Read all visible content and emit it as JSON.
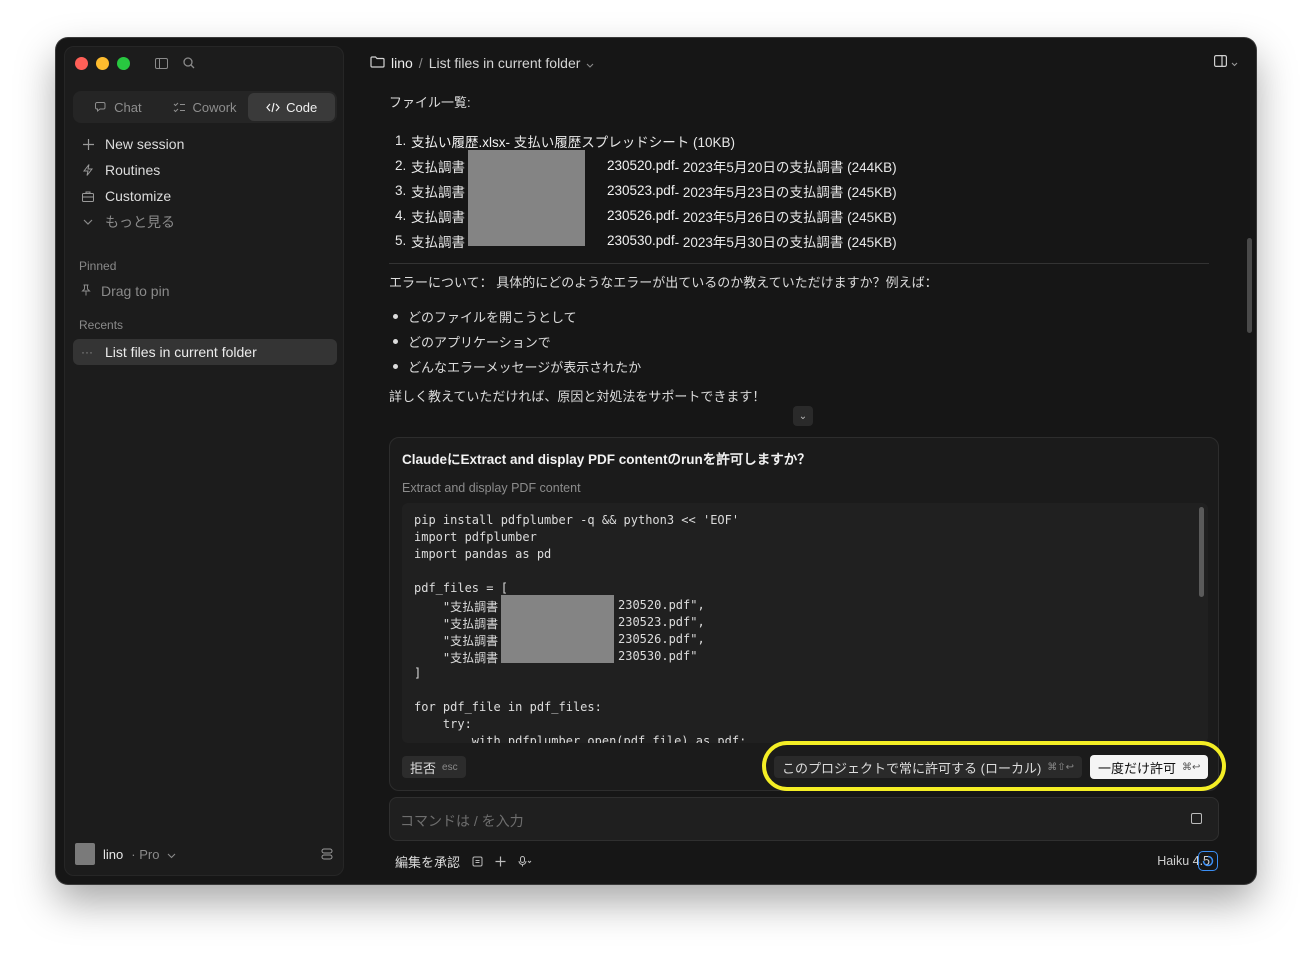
{
  "sidebar": {
    "modes": [
      {
        "label": "Chat",
        "icon": "chat-icon"
      },
      {
        "label": "Cowork",
        "icon": "cowork-icon"
      },
      {
        "label": "Code",
        "icon": "code-icon",
        "active": true
      }
    ],
    "nav": [
      {
        "label": "New session",
        "icon": "plus-icon"
      },
      {
        "label": "Routines",
        "icon": "bolt-icon"
      },
      {
        "label": "Customize",
        "icon": "briefcase-icon"
      },
      {
        "label": "もっと見る",
        "icon": "chevron-down-icon"
      }
    ],
    "pinned_label": "Pinned",
    "pin_hint": "Drag to pin",
    "recents_label": "Recents",
    "recent_item": "List files in current folder",
    "account": {
      "name": "lino",
      "plan": "· Pro"
    }
  },
  "header": {
    "project": "lino",
    "separator": "/",
    "title": "List files in current folder"
  },
  "content": {
    "files_heading": "ファイル一覧:",
    "files": [
      {
        "num": "1.",
        "name": "支払い履歴.xlsx",
        "desc": " - 支払い履歴スプレッドシート (10KB)"
      },
      {
        "num": "2.",
        "name_pre": "支払調書",
        "name": "230520.pdf",
        "desc": " - 2023年5月20日の支払調書 (244KB)"
      },
      {
        "num": "3.",
        "name_pre": "支払調書",
        "name": "230523.pdf",
        "desc": " - 2023年5月23日の支払調書 (245KB)"
      },
      {
        "num": "4.",
        "name_pre": "支払調書",
        "name": "230526.pdf",
        "desc": " - 2023年5月26日の支払調書 (245KB)"
      },
      {
        "num": "5.",
        "name_pre": "支払調書",
        "name": "230530.pdf",
        "desc": " - 2023年5月30日の支払調書 (245KB)"
      }
    ],
    "error_text": "エラーについて： 具体的にどのようなエラーが出ているのか教えていただけますか？例えば：",
    "bullets": [
      "どのファイルを開こうとして",
      "どのアプリケーションで",
      "どんなエラーメッセージが表示されたか"
    ],
    "closing": "詳しく教えていただければ、原因と対処法をサポートできます！",
    "collapse_glyph": "⌄"
  },
  "permission": {
    "title": "ClaudeにExtract and display PDF contentのrunを許可しますか？",
    "subtitle": "Extract and display PDF content",
    "code_lines": [
      "pip install pdfplumber -q && python3 << 'EOF'",
      "import pdfplumber",
      "import pandas as pd",
      "",
      "pdf_files = [",
      "    \"支払調書",
      "    \"支払調書",
      "    \"支払調書",
      "    \"支払調書",
      "]",
      "",
      "for pdf_file in pdf_files:",
      "    try:",
      "        with pdfplumber.open(pdf_file) as pdf:"
    ],
    "code_suffixes": [
      "230520.pdf\",",
      "230523.pdf\",",
      "230526.pdf\",",
      "230530.pdf\""
    ],
    "reject_label": "拒否",
    "reject_key": "esc",
    "always_label": "このプロジェクトで常に許可する (ローカル)",
    "always_key": "⌘⇧↩",
    "once_label": "一度だけ許可",
    "once_key": "⌘↩"
  },
  "input": {
    "placeholder": "コマンドは / を入力"
  },
  "footer": {
    "approve_label": "編集を承認",
    "model": "Haiku 4.5"
  },
  "colors": {
    "accent_ring": "#f4ee25",
    "model_icon": "#3b8ff5",
    "redaction": "#848484"
  }
}
